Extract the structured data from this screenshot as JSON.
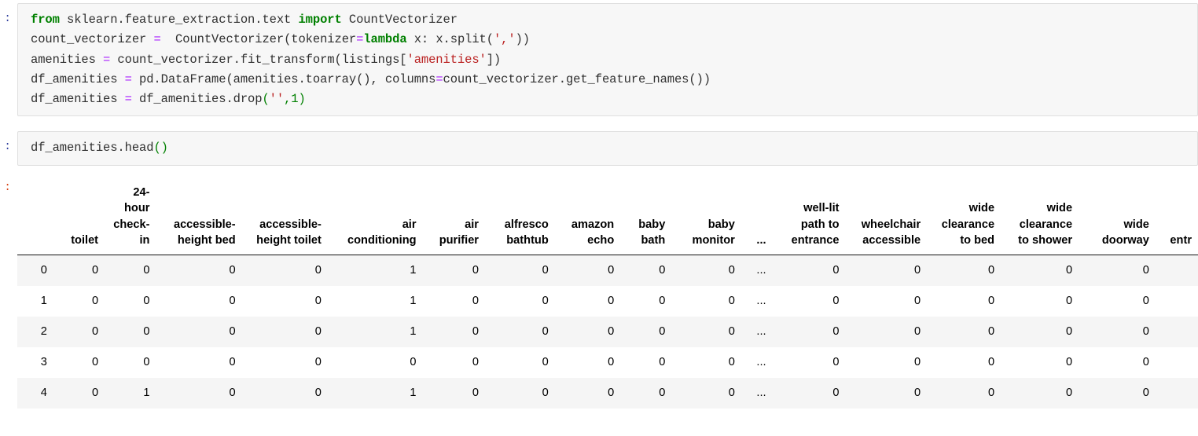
{
  "cells": [
    {
      "type": "code",
      "prompt": ":",
      "lines": [
        [
          {
            "t": "from ",
            "c": "kw"
          },
          {
            "t": "sklearn.feature_extraction.text ",
            "c": "pl"
          },
          {
            "t": "import ",
            "c": "kw"
          },
          {
            "t": "CountVectorizer",
            "c": "pl"
          }
        ],
        [
          {
            "t": "count_vectorizer ",
            "c": "pl"
          },
          {
            "t": "=",
            "c": "op"
          },
          {
            "t": "  CountVectorizer",
            "c": "pl"
          },
          {
            "t": "(",
            "c": "pl"
          },
          {
            "t": "tokenizer",
            "c": "pl"
          },
          {
            "t": "=",
            "c": "op"
          },
          {
            "t": "lambda",
            "c": "kw"
          },
          {
            "t": " x: x.split",
            "c": "pl"
          },
          {
            "t": "(",
            "c": "pl"
          },
          {
            "t": "','",
            "c": "str"
          },
          {
            "t": "))",
            "c": "pl"
          }
        ],
        [
          {
            "t": "amenities ",
            "c": "pl"
          },
          {
            "t": "=",
            "c": "op"
          },
          {
            "t": " count_vectorizer.fit_transform",
            "c": "pl"
          },
          {
            "t": "(",
            "c": "pl"
          },
          {
            "t": "listings",
            "c": "pl"
          },
          {
            "t": "[",
            "c": "pl"
          },
          {
            "t": "'amenities'",
            "c": "str"
          },
          {
            "t": "])",
            "c": "pl"
          }
        ],
        [
          {
            "t": "df_amenities ",
            "c": "pl"
          },
          {
            "t": "=",
            "c": "op"
          },
          {
            "t": " pd.DataFrame",
            "c": "pl"
          },
          {
            "t": "(",
            "c": "pl"
          },
          {
            "t": "amenities.toarray",
            "c": "pl"
          },
          {
            "t": "()",
            "c": "pl"
          },
          {
            "t": ", columns",
            "c": "pl"
          },
          {
            "t": "=",
            "c": "op"
          },
          {
            "t": "count_vectorizer.get_feature_names",
            "c": "pl"
          },
          {
            "t": "())",
            "c": "pl"
          }
        ],
        [
          {
            "t": "df_amenities ",
            "c": "pl"
          },
          {
            "t": "=",
            "c": "op"
          },
          {
            "t": " df_amenities.drop",
            "c": "pl"
          },
          {
            "t": "(",
            "c": "punc"
          },
          {
            "t": "''",
            "c": "str"
          },
          {
            "t": ",",
            "c": "punc"
          },
          {
            "t": "1",
            "c": "num"
          },
          {
            "t": ")",
            "c": "punc"
          }
        ]
      ]
    },
    {
      "type": "code",
      "prompt": ":",
      "lines": [
        [
          {
            "t": "df_amenities.head",
            "c": "pl"
          },
          {
            "t": "()",
            "c": "punc"
          }
        ]
      ]
    }
  ],
  "output": {
    "prompt": ":",
    "dataframe": {
      "index_header": "",
      "columns": [
        "toilet",
        "24-hour check-in",
        "accessible-height bed",
        "accessible-height toilet",
        "air conditioning",
        "air purifier",
        "alfresco bathtub",
        "amazon echo",
        "baby bath",
        "baby monitor",
        "...",
        "well-lit path to entrance",
        "wheelchair accessible",
        "wide clearance to bed",
        "wide clearance to shower",
        "wide doorway",
        "entr"
      ],
      "index": [
        "0",
        "1",
        "2",
        "3",
        "4"
      ],
      "rows": [
        [
          "0",
          "0",
          "0",
          "0",
          "1",
          "0",
          "0",
          "0",
          "0",
          "0",
          "...",
          "0",
          "0",
          "0",
          "0",
          "0",
          ""
        ],
        [
          "0",
          "0",
          "0",
          "0",
          "1",
          "0",
          "0",
          "0",
          "0",
          "0",
          "...",
          "0",
          "0",
          "0",
          "0",
          "0",
          ""
        ],
        [
          "0",
          "0",
          "0",
          "0",
          "1",
          "0",
          "0",
          "0",
          "0",
          "0",
          "...",
          "0",
          "0",
          "0",
          "0",
          "0",
          ""
        ],
        [
          "0",
          "0",
          "0",
          "0",
          "0",
          "0",
          "0",
          "0",
          "0",
          "0",
          "...",
          "0",
          "0",
          "0",
          "0",
          "0",
          ""
        ],
        [
          "0",
          "1",
          "0",
          "0",
          "1",
          "0",
          "0",
          "0",
          "0",
          "0",
          "...",
          "0",
          "0",
          "0",
          "0",
          "0",
          ""
        ]
      ]
    }
  },
  "colors": {
    "keyword": "#008000",
    "string": "#BA2121",
    "operator": "#AA22FF",
    "number": "#008000",
    "in_prompt": "#303F9F",
    "out_prompt": "#D84315",
    "cell_bg": "#f7f7f7",
    "cell_border": "#dfdfdf",
    "row_stripe": "#f5f5f5"
  }
}
